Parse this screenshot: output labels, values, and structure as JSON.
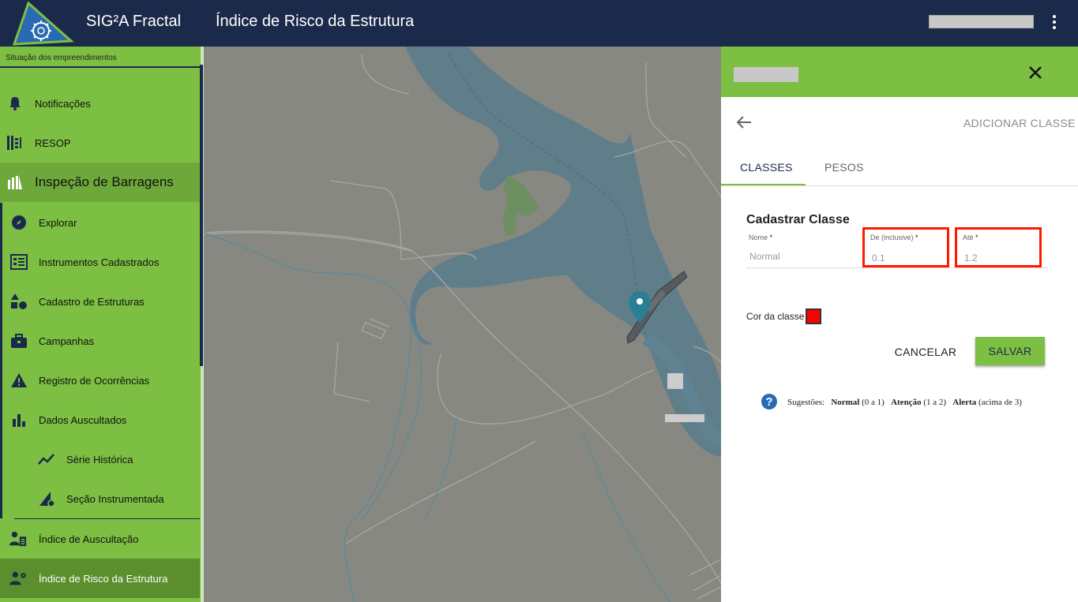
{
  "header": {
    "app_title": "SIG²A Fractal",
    "page_title": "Índice de Risco da Estrutura"
  },
  "sidebar": {
    "caption": "Situação dos empreendimentos",
    "items": [
      {
        "label": "Notificações",
        "icon": "bell-icon"
      },
      {
        "label": "RESOP",
        "icon": "resop-icon"
      },
      {
        "label": "Inspeção de Barragens",
        "icon": "dam-icon"
      },
      {
        "label": "Explorar",
        "icon": "compass-icon"
      },
      {
        "label": "Instrumentos Cadastrados",
        "icon": "instrument-icon"
      },
      {
        "label": "Cadastro de Estruturas",
        "icon": "shapes-icon"
      },
      {
        "label": "Campanhas",
        "icon": "briefcase-icon"
      },
      {
        "label": "Registro de Ocorrências",
        "icon": "warning-icon"
      },
      {
        "label": "Dados Auscultados",
        "icon": "bar-chart-icon"
      },
      {
        "label": "Série Histórica",
        "icon": "line-chart-icon"
      },
      {
        "label": "Seção Instrumentada",
        "icon": "section-gear-icon"
      },
      {
        "label": "Índice de Auscultação",
        "icon": "person-clipboard-icon"
      },
      {
        "label": "Índice de Risco da Estrutura",
        "icon": "person-gear-icon"
      }
    ]
  },
  "panel": {
    "add_class": "ADICIONAR CLASSE",
    "tabs": [
      {
        "label": "CLASSES",
        "active": true
      },
      {
        "label": "PESOS",
        "active": false
      }
    ],
    "form_title": "Cadastrar Classe",
    "fields": {
      "nome": {
        "label": "Nome",
        "required": "*",
        "value": "Normal"
      },
      "de": {
        "label": "De (inclusive)",
        "required": "*",
        "value": "0.1"
      },
      "ate": {
        "label": "Até",
        "required": "*",
        "value": "1.2"
      }
    },
    "color_label": "Cor da classe",
    "color_value": "#ff0000",
    "cancel_label": "CANCELAR",
    "save_label": "SALVAR",
    "suggestions": {
      "prefix": "Sugestões:",
      "items": [
        {
          "name": "Normal",
          "range": "(0 a 1)"
        },
        {
          "name": "Atenção",
          "range": "(1 a 2)"
        },
        {
          "name": "Alerta",
          "range": "(acima de 3)"
        }
      ]
    }
  },
  "colors": {
    "header_bg": "#1b2a4a",
    "accent_green": "#7cbf42",
    "active_item": "#5b8e2c",
    "highlight_red": "#ff1a00"
  }
}
